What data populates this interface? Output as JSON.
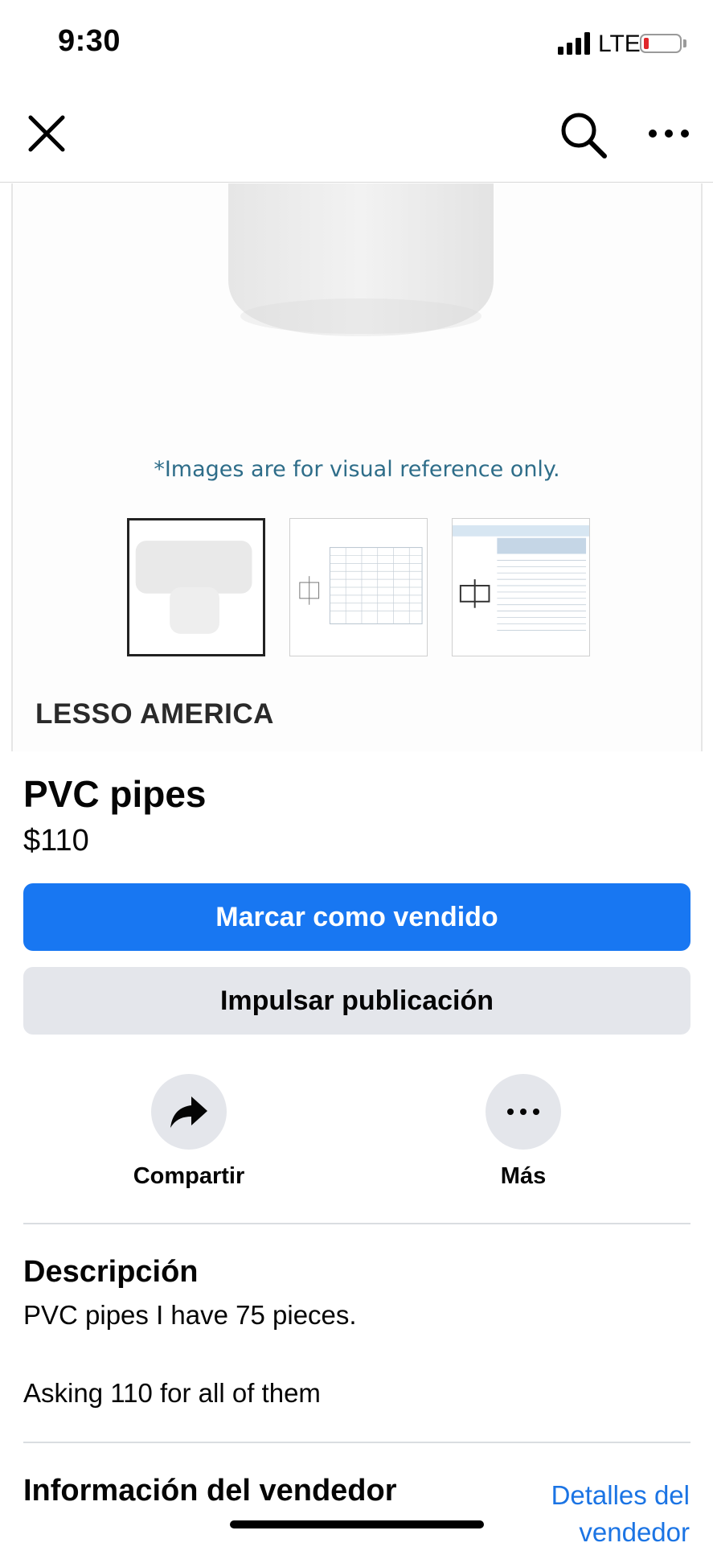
{
  "status_bar": {
    "time": "9:30",
    "network": "LTE",
    "battery_icon": "battery-low-icon"
  },
  "nav": {
    "close_icon": "close-icon",
    "search_icon": "search-icon",
    "more_icon": "more-icon"
  },
  "listing_image": {
    "disclaimer": "*Images are for visual reference only.",
    "brand": "LESSO AMERICA",
    "selected_thumbnail_index": 0
  },
  "product": {
    "title": "PVC pipes",
    "price": "$110"
  },
  "buttons": {
    "mark_sold": "Marcar como vendido",
    "boost": "Impulsar publicación"
  },
  "actions": {
    "share": "Compartir",
    "more": "Más"
  },
  "description": {
    "title": "Descripción",
    "line1": "PVC pipes I have 75 pieces.",
    "line2": "Asking 110 for all of them"
  },
  "seller": {
    "title": "Información del vendedor",
    "details_link": "Detalles del vendedor"
  },
  "colors": {
    "primary": "#1877f2",
    "secondary_bg": "#e4e6eb",
    "link": "#1b74e4"
  }
}
